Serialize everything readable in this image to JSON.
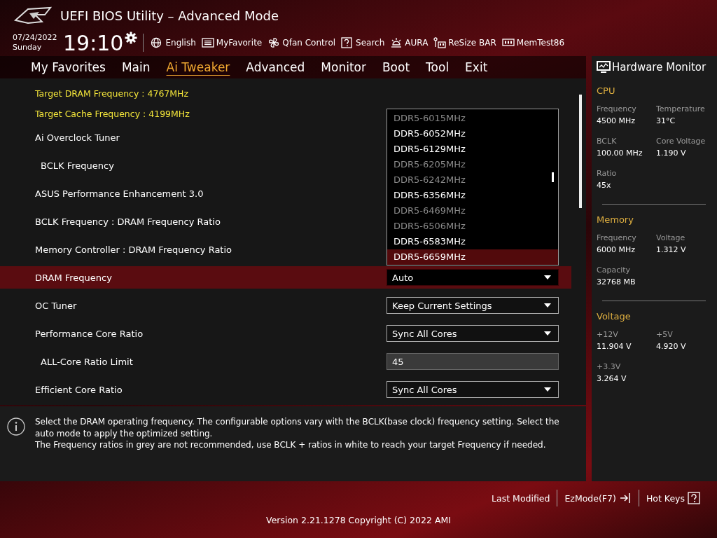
{
  "header": {
    "title": "UEFI BIOS Utility – Advanced Mode",
    "date": "07/24/2022",
    "day": "Sunday",
    "time": "19:10",
    "toolbar": [
      {
        "kind": "language",
        "label": "English"
      },
      {
        "kind": "favorite",
        "label": "MyFavorite"
      },
      {
        "kind": "fan",
        "label": "Qfan Control"
      },
      {
        "kind": "search",
        "label": "Search"
      },
      {
        "kind": "aura",
        "label": "AURA"
      },
      {
        "kind": "resize",
        "label": "ReSize BAR"
      },
      {
        "kind": "memtest",
        "label": "MemTest86"
      }
    ]
  },
  "tabs": [
    {
      "label": "My Favorites",
      "selected": false
    },
    {
      "label": "Main",
      "selected": false
    },
    {
      "label": "Ai Tweaker",
      "selected": true
    },
    {
      "label": "Advanced",
      "selected": false
    },
    {
      "label": "Monitor",
      "selected": false
    },
    {
      "label": "Boot",
      "selected": false
    },
    {
      "label": "Tool",
      "selected": false
    },
    {
      "label": "Exit",
      "selected": false
    }
  ],
  "info_lines": [
    "Target DRAM Frequency : 4767MHz",
    "Target Cache Frequency : 4199MHz"
  ],
  "settings": [
    {
      "label": "Ai Overclock Tuner",
      "selected": false,
      "children": [
        {
          "label": "BCLK Frequency",
          "selected": false
        }
      ]
    },
    {
      "label": "ASUS Performance Enhancement 3.0",
      "selected": false
    },
    {
      "label": "BCLK Frequency : DRAM Frequency Ratio",
      "selected": false
    },
    {
      "label": "Memory Controller : DRAM Frequency Ratio",
      "selected": false
    },
    {
      "label": "DRAM Frequency",
      "selected": true,
      "control": {
        "kind": "dropdown",
        "value": "Auto"
      }
    },
    {
      "label": "OC Tuner",
      "selected": false,
      "control": {
        "kind": "dropdown",
        "value": "Keep Current Settings"
      }
    },
    {
      "label": "Performance Core Ratio",
      "selected": false,
      "control": {
        "kind": "dropdown",
        "value": "Sync All Cores"
      },
      "children": [
        {
          "label": "ALL-Core Ratio Limit",
          "selected": false,
          "control": {
            "kind": "input",
            "value": "45"
          }
        }
      ]
    },
    {
      "label": "Efficient Core Ratio",
      "selected": false,
      "control": {
        "kind": "dropdown",
        "value": "Sync All Cores"
      }
    }
  ],
  "dropdown_list": {
    "options": [
      {
        "label": "DDR5-6015MHz",
        "recommended": false,
        "selected": false
      },
      {
        "label": "DDR5-6052MHz",
        "recommended": true,
        "selected": false
      },
      {
        "label": "DDR5-6129MHz",
        "recommended": true,
        "selected": false
      },
      {
        "label": "DDR5-6205MHz",
        "recommended": false,
        "selected": false
      },
      {
        "label": "DDR5-6242MHz",
        "recommended": false,
        "selected": false
      },
      {
        "label": "DDR5-6356MHz",
        "recommended": true,
        "selected": false
      },
      {
        "label": "DDR5-6469MHz",
        "recommended": false,
        "selected": false
      },
      {
        "label": "DDR5-6506MHz",
        "recommended": false,
        "selected": false
      },
      {
        "label": "DDR5-6583MHz",
        "recommended": true,
        "selected": false
      },
      {
        "label": "DDR5-6659MHz",
        "recommended": true,
        "selected": true
      }
    ]
  },
  "help": [
    "Select the DRAM operating frequency. The configurable options vary with the BCLK(base clock) frequency setting. Select the auto mode to apply the optimized setting.",
    "The Frequency ratios in grey are not recommended, use BCLK + ratios in white to reach your target Frequency if needed."
  ],
  "hardware_monitor": {
    "title": "Hardware Monitor",
    "sections": [
      {
        "title": "CPU",
        "items": [
          {
            "label": "Frequency",
            "value": "4500 MHz"
          },
          {
            "label": "Temperature",
            "value": "31°C"
          },
          {
            "label": "BCLK",
            "value": "100.00 MHz"
          },
          {
            "label": "Core Voltage",
            "value": "1.190 V"
          },
          {
            "label": "Ratio",
            "value": "45x"
          }
        ]
      },
      {
        "title": "Memory",
        "items": [
          {
            "label": "Frequency",
            "value": "6000 MHz"
          },
          {
            "label": "Voltage",
            "value": "1.312 V"
          },
          {
            "label": "Capacity",
            "value": "32768 MB"
          }
        ]
      },
      {
        "title": "Voltage",
        "items": [
          {
            "label": "+12V",
            "value": "11.904 V"
          },
          {
            "label": "+5V",
            "value": "4.920 V"
          },
          {
            "label": "+3.3V",
            "value": "3.264 V"
          }
        ]
      }
    ]
  },
  "footer": {
    "buttons": [
      {
        "kind": "plain",
        "label": "Last Modified"
      },
      {
        "kind": "exit",
        "label": "EzMode(F7)"
      },
      {
        "kind": "help",
        "label": "Hot Keys"
      }
    ],
    "version": "Version 2.21.1278 Copyright (C) 2022 AMI"
  }
}
